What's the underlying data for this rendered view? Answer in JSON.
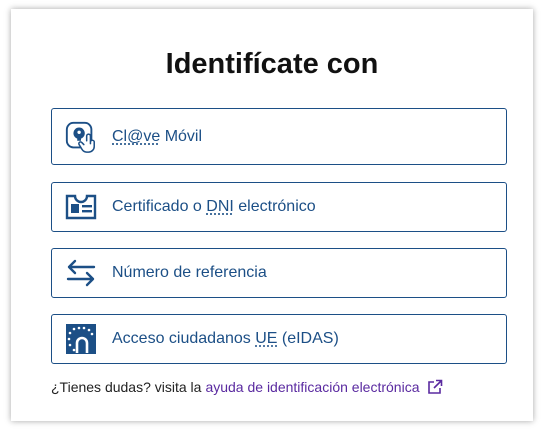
{
  "title": "Identifícate con",
  "options": [
    {
      "label_abbr": "Cl@ve",
      "label_rest": " Móvil",
      "icon": "clave-movil-icon"
    },
    {
      "label_pre": "Certificado o ",
      "label_abbr": "DNI",
      "label_rest": " electrónico",
      "icon": "id-card-icon"
    },
    {
      "label": "Número de referencia",
      "icon": "swap-arrows-icon"
    },
    {
      "label_pre": "Acceso ciudadanos ",
      "label_abbr": "UE",
      "label_rest": " (eIDAS)",
      "icon": "eu-flag-icon"
    }
  ],
  "footer": {
    "text": "¿Tienes dudas? visita la",
    "link": "ayuda de identificación electrónica",
    "link_icon": "external-link-icon"
  },
  "colors": {
    "primary": "#1c4f86",
    "link": "#5a2aa0",
    "title": "#111111"
  }
}
